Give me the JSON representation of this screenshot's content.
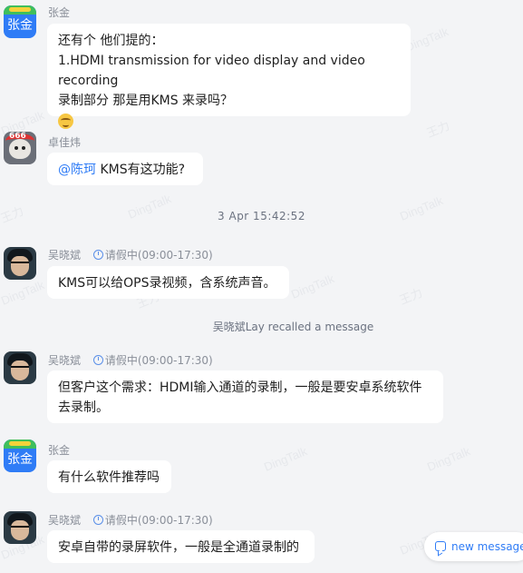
{
  "watermarks": [
    {
      "text": "DingTalk"
    },
    {
      "text": "王力"
    },
    {
      "text": "DingTalk"
    },
    {
      "text": "DingTalk"
    },
    {
      "text": "王力"
    },
    {
      "text": "DingTalk"
    },
    {
      "text": "DingTalk"
    },
    {
      "text": "王力"
    },
    {
      "text": "DingTalk"
    },
    {
      "text": "王力"
    },
    {
      "text": "DingTalk"
    },
    {
      "text": "DingTalk"
    },
    {
      "text": "王力"
    },
    {
      "text": "DingTalk"
    },
    {
      "text": "王力"
    },
    {
      "text": "DingTalk"
    }
  ],
  "messages": [
    {
      "sender": "张金",
      "avatar_text": "张金",
      "lines": [
        "还有个 他们提的：",
        "1.HDMI transmission for video display and video recording",
        "录制部分 那是用KMS 来录吗？"
      ],
      "emoji": "grinning-sweat-emoji"
    },
    {
      "sender": "卓佳炜",
      "avatar_text": "666",
      "mention": "@陈珂",
      "text": " KMS有这功能?"
    },
    {
      "sender": "吴晓斌",
      "status": "请假中(09:00-17:30)",
      "text": "KMS可以给OPS录视频，含系统声音。"
    },
    {
      "sender": "吴晓斌",
      "status": "请假中(09:00-17:30)",
      "lines": [
        "但客户这个需求：HDMI输入通道的录制，一般是要安卓系统软件",
        "去录制。"
      ]
    },
    {
      "sender": "张金",
      "avatar_text": "张金",
      "text": "有什么软件推荐吗"
    },
    {
      "sender": "吴晓斌",
      "status": "请假中(09:00-17:30)",
      "text": "安卓自带的录屏软件，一般是全通道录制的"
    }
  ],
  "timestamp": "3 Apr 15:42:52",
  "recall_notice": "吴晓斌Lay recalled a message",
  "new_message_button": "new message",
  "colors": {
    "background": "#f3f4f6",
    "bubble": "#ffffff",
    "accent": "#2f7cf6"
  }
}
